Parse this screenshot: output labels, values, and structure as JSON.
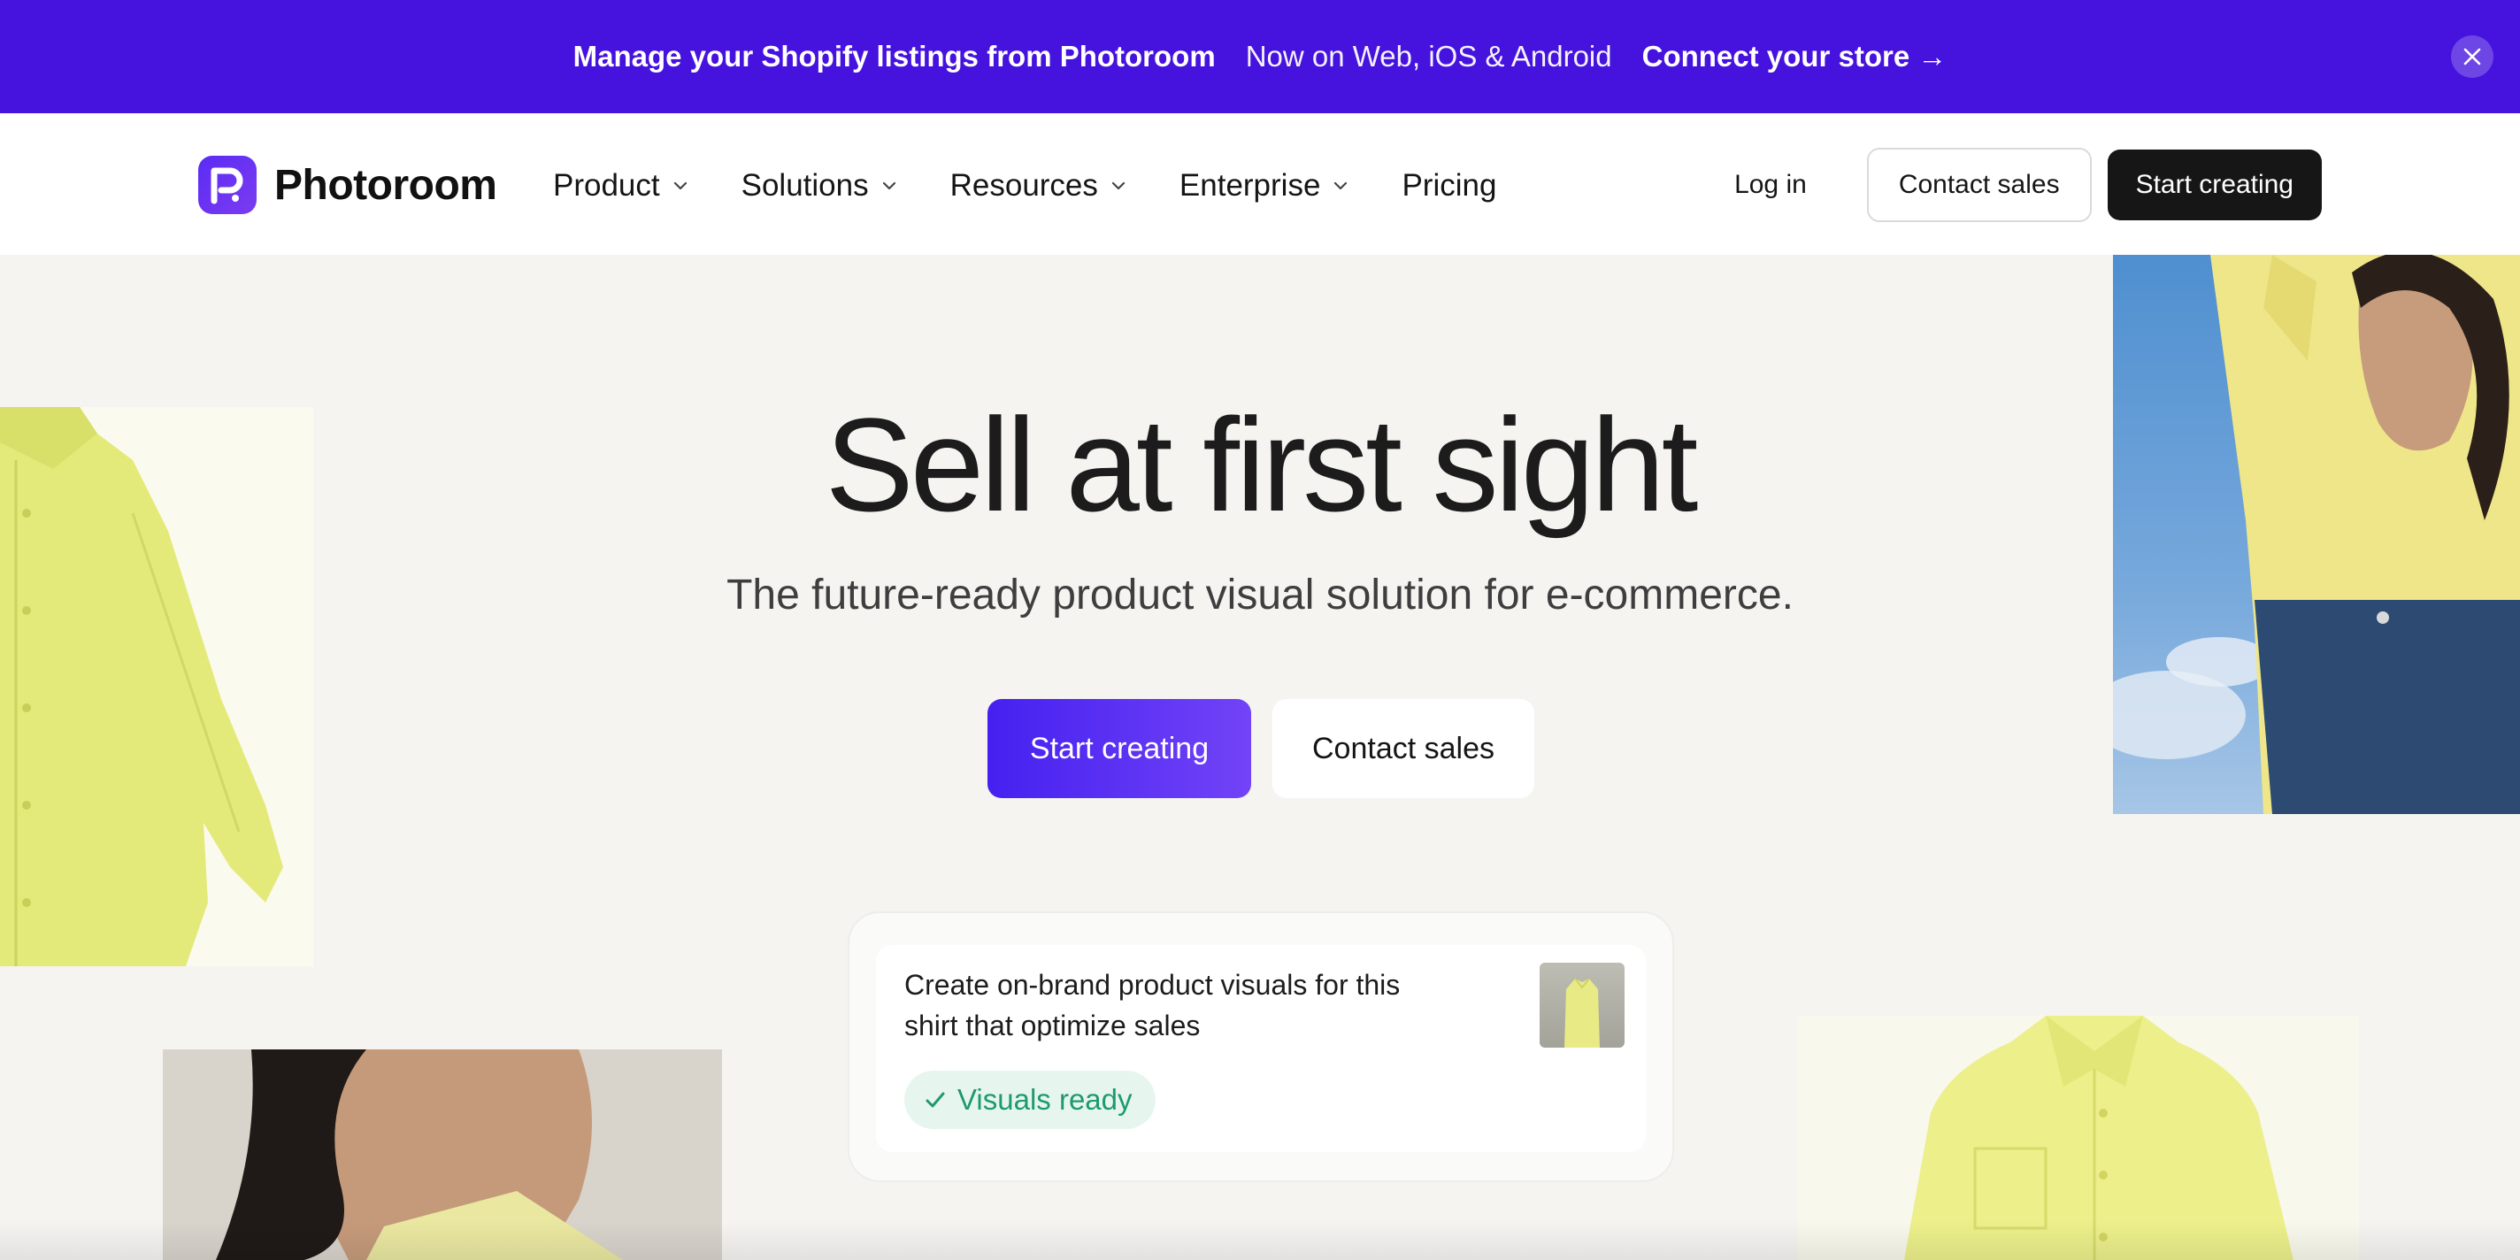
{
  "announcement": {
    "message": "Manage your Shopify listings from Photoroom",
    "platforms": "Now on Web, iOS & Android",
    "link_label": "Connect your store →"
  },
  "nav": {
    "brand": "Photoroom",
    "items": [
      {
        "label": "Product",
        "has_dropdown": true
      },
      {
        "label": "Solutions",
        "has_dropdown": true
      },
      {
        "label": "Resources",
        "has_dropdown": true
      },
      {
        "label": "Enterprise",
        "has_dropdown": true
      },
      {
        "label": "Pricing",
        "has_dropdown": false
      }
    ],
    "login_label": "Log in",
    "contact_label": "Contact sales",
    "start_label": "Start creating"
  },
  "hero": {
    "title": "Sell at first sight",
    "subtitle": "The future-ready product visual solution for e-commerce.",
    "primary_cta": "Start creating",
    "secondary_cta": "Contact sales"
  },
  "prompt_card": {
    "text": "Create on-brand product visuals for this shirt that optimize sales",
    "status": "Visuals ready"
  },
  "colors": {
    "announcement_bg": "#4512de",
    "primary_gradient_start": "#4520f0",
    "primary_gradient_end": "#7243f7",
    "dark_button": "#161616",
    "page_bg": "#f5f4f1",
    "status_green": "#1f9a6a"
  },
  "icons": {
    "close": "close-icon",
    "chevron": "chevron-down-icon",
    "check": "check-icon",
    "logo": "photoroom-logo-icon"
  }
}
